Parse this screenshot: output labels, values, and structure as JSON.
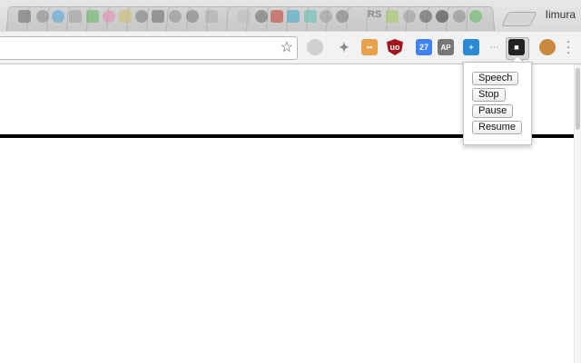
{
  "browser": {
    "profile_name": "Iimura",
    "tab_count": 20
  },
  "toolbar": {
    "bookmark_icon": "star-icon",
    "extensions": [
      {
        "name": "disabled-extension-icon",
        "color": "#c8c8c8",
        "label": ""
      },
      {
        "name": "puzzle-icon",
        "color": "#9a9a9a",
        "label": ""
      },
      {
        "name": "face-icon",
        "color": "#e9a24b",
        "label": ""
      },
      {
        "name": "ublock-icon",
        "color": "#a3151a",
        "label": "uo"
      },
      {
        "name": "calendar-icon",
        "color": "#3f82f0",
        "label": "27"
      },
      {
        "name": "ap-icon",
        "color": "#777777",
        "label": "AP"
      },
      {
        "name": "translate-icon",
        "color": "#2b8ad6",
        "label": "+"
      },
      {
        "name": "dots-extension-icon",
        "color": "#d4d4d4",
        "label": ""
      },
      {
        "name": "speech-extension-icon",
        "color": "#222222",
        "label": ""
      },
      {
        "name": "cookie-icon",
        "color": "#c9893e",
        "label": ""
      }
    ],
    "menu_icon": "vertical-dots-icon"
  },
  "popup": {
    "buttons": {
      "speech": "Speech",
      "stop": "Stop",
      "pause": "Pause",
      "resume": "Resume"
    }
  },
  "colors": {
    "rule": "#000000",
    "tabstrip": "#e0e0e0",
    "toolbar": "#f2f2f2"
  }
}
